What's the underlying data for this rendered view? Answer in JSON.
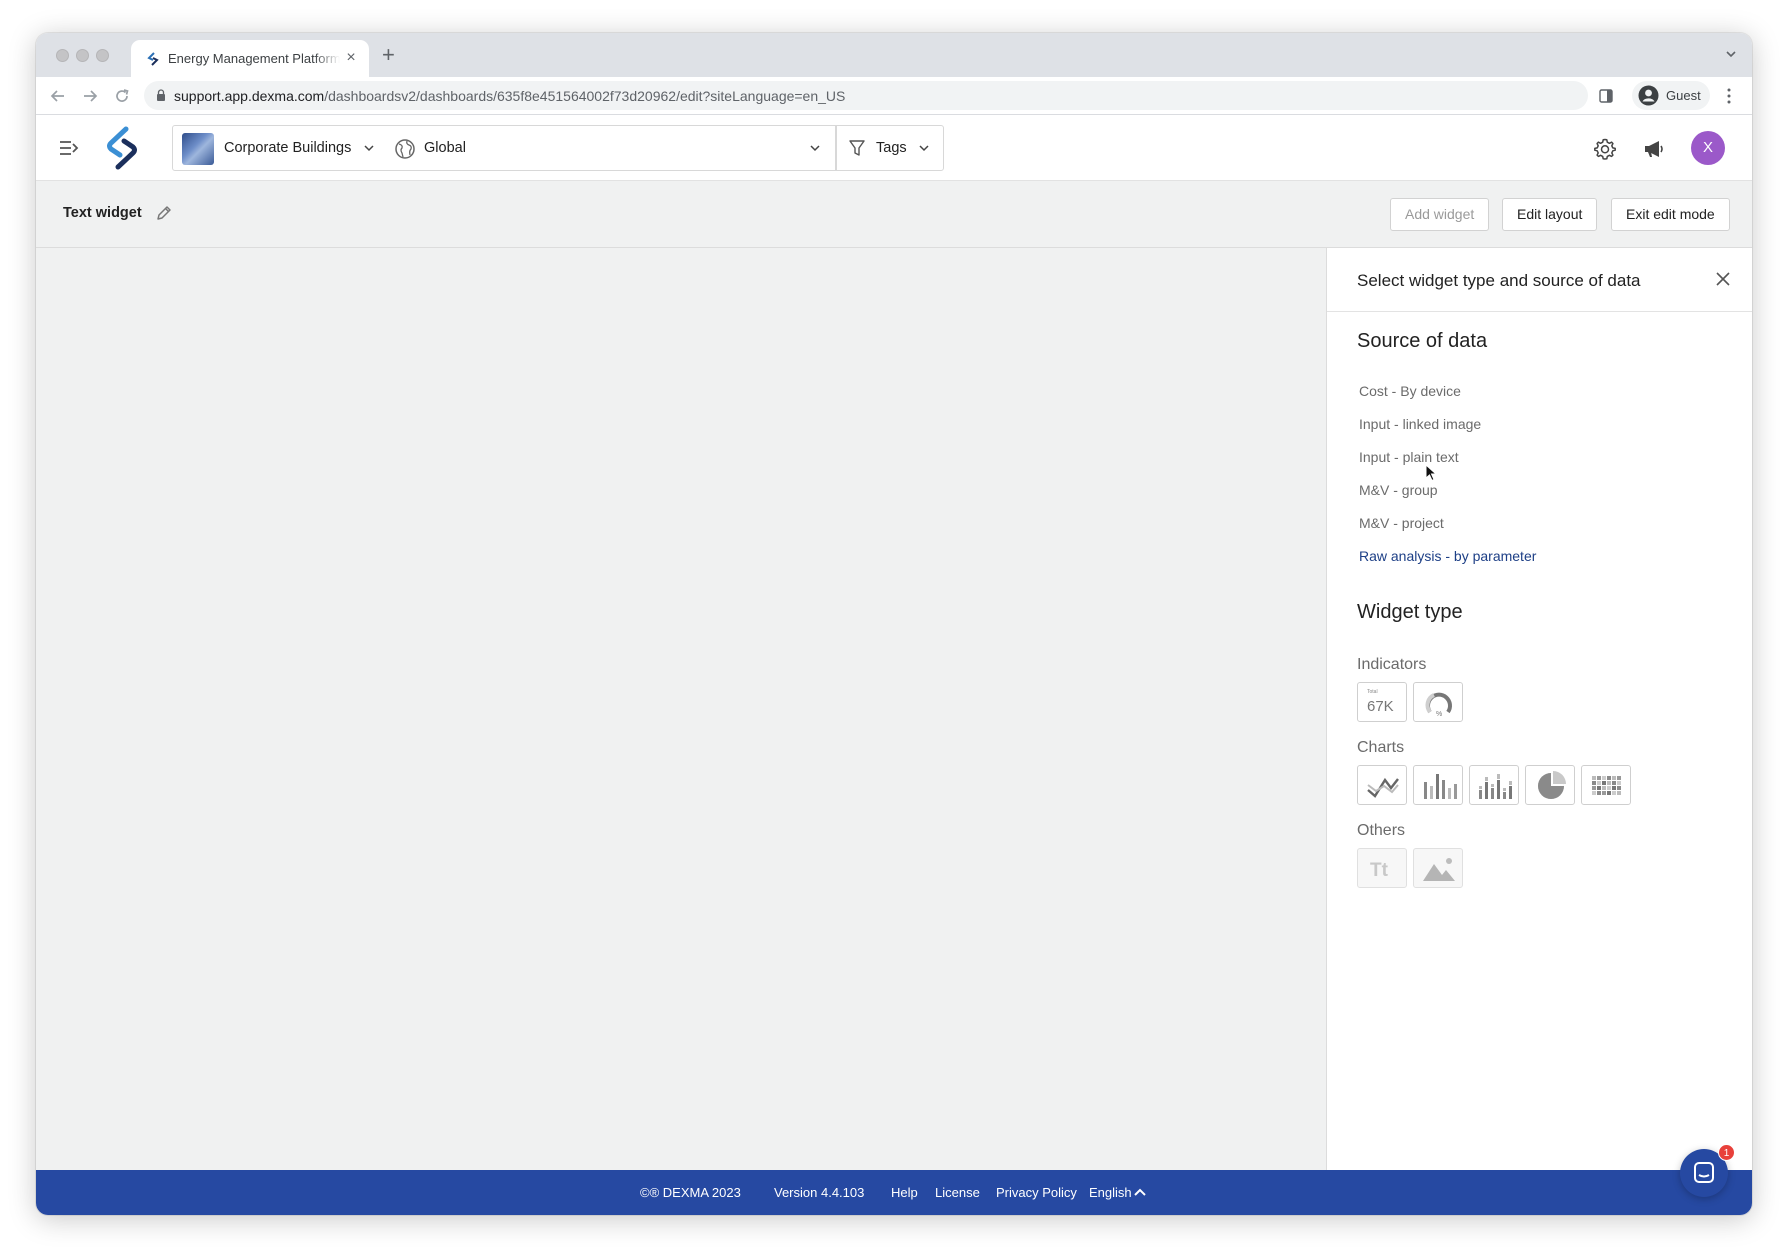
{
  "browser": {
    "tab_title": "Energy Management Platform",
    "url_host": "support.app.dexma.com",
    "url_path": "/dashboardsv2/dashboards/635f8e451564002f73d20962/edit?siteLanguage=en_US",
    "profile_label": "Guest"
  },
  "header": {
    "organization": "Corporate Buildings",
    "location": "Global",
    "tags_label": "Tags",
    "avatar_initial": "X",
    "avatar_color": "#9b59c9"
  },
  "toolbar": {
    "dashboard_title": "Text widget",
    "add_widget": "Add widget",
    "edit_layout": "Edit layout",
    "exit_edit_mode": "Exit edit mode"
  },
  "panel": {
    "title": "Select widget type and source of data",
    "source_heading": "Source of data",
    "sources": [
      {
        "label": "Cost - By device",
        "active": false
      },
      {
        "label": "Input - linked image",
        "active": false
      },
      {
        "label": "Input - plain text",
        "active": false
      },
      {
        "label": "M&V - group",
        "active": false
      },
      {
        "label": "M&V - project",
        "active": false
      },
      {
        "label": "Raw analysis - by parameter",
        "active": true
      }
    ],
    "widget_type_heading": "Widget type",
    "indicators_label": "Indicators",
    "indicator_total_small": "Total",
    "indicator_total_value": "67K",
    "indicator_gauge_unit": "%",
    "charts_label": "Charts",
    "others_label": "Others",
    "text_widget_glyph": "Tt"
  },
  "footer": {
    "copyright": "©® DEXMA 2023",
    "version": "Version 4.4.103",
    "help": "Help",
    "license": "License",
    "privacy": "Privacy Policy",
    "language": "English"
  },
  "chat": {
    "badge_count": "1"
  },
  "colors": {
    "brand_blue": "#2649a2",
    "active_link": "#1d3f86",
    "canvas_bg": "#f0f1f1"
  }
}
